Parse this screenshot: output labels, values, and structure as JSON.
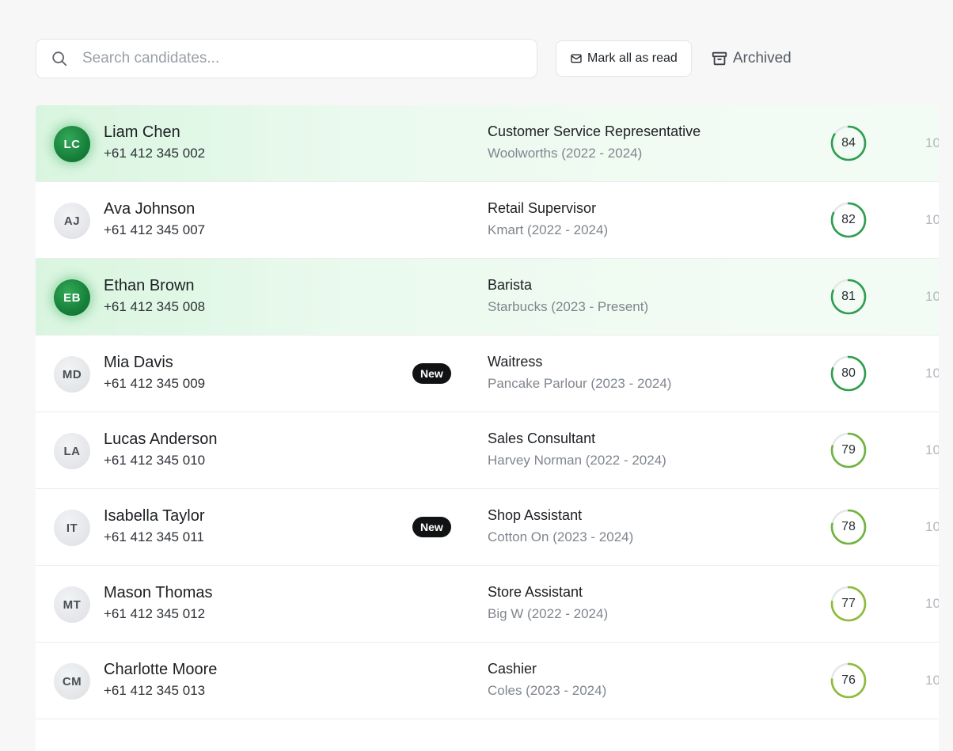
{
  "search": {
    "placeholder": "Search candidates..."
  },
  "toolbar": {
    "mark_all_read_label": "Mark all as read",
    "archived_label": "Archived"
  },
  "candidates": [
    {
      "initials": "LC",
      "name": "Liam Chen",
      "phone": "+61 412 345 002",
      "badge": "",
      "job_title": "Customer Service Representative",
      "job_company": "Woolworths (2022 - 2024)",
      "score": 84,
      "trail": "10",
      "highlight": true
    },
    {
      "initials": "AJ",
      "name": "Ava Johnson",
      "phone": "+61 412 345 007",
      "badge": "",
      "job_title": "Retail Supervisor",
      "job_company": "Kmart (2022 - 2024)",
      "score": 82,
      "trail": "10",
      "highlight": false
    },
    {
      "initials": "EB",
      "name": "Ethan Brown",
      "phone": "+61 412 345 008",
      "badge": "",
      "job_title": "Barista",
      "job_company": "Starbucks (2023 - Present)",
      "score": 81,
      "trail": "10",
      "highlight": true
    },
    {
      "initials": "MD",
      "name": "Mia Davis",
      "phone": "+61 412 345 009",
      "badge": "New",
      "job_title": "Waitress",
      "job_company": "Pancake Parlour (2023 - 2024)",
      "score": 80,
      "trail": "10",
      "highlight": false
    },
    {
      "initials": "LA",
      "name": "Lucas Anderson",
      "phone": "+61 412 345 010",
      "badge": "",
      "job_title": "Sales Consultant",
      "job_company": "Harvey Norman (2022 - 2024)",
      "score": 79,
      "trail": "10",
      "highlight": false
    },
    {
      "initials": "IT",
      "name": "Isabella Taylor",
      "phone": "+61 412 345 011",
      "badge": "New",
      "job_title": "Shop Assistant",
      "job_company": "Cotton On (2023 - 2024)",
      "score": 78,
      "trail": "10",
      "highlight": false
    },
    {
      "initials": "MT",
      "name": "Mason Thomas",
      "phone": "+61 412 345 012",
      "badge": "",
      "job_title": "Store Assistant",
      "job_company": "Big W (2022 - 2024)",
      "score": 77,
      "trail": "10",
      "highlight": false
    },
    {
      "initials": "CM",
      "name": "Charlotte Moore",
      "phone": "+61 412 345 013",
      "badge": "",
      "job_title": "Cashier",
      "job_company": "Coles (2023 - 2024)",
      "score": 76,
      "trail": "10",
      "highlight": false
    }
  ],
  "colors": {
    "score_ring_high": "#2e9e4f",
    "score_ring_mid": "#6fb33f",
    "score_ring_low": "#8dbb3a",
    "score_track": "#e6e7ea",
    "active_avatar": "#17803b",
    "highlight_row": "#e3f7e8"
  },
  "icons": {
    "search": "search-icon",
    "mark_all_read": "envelope-icon",
    "archived": "archive-box-icon"
  }
}
